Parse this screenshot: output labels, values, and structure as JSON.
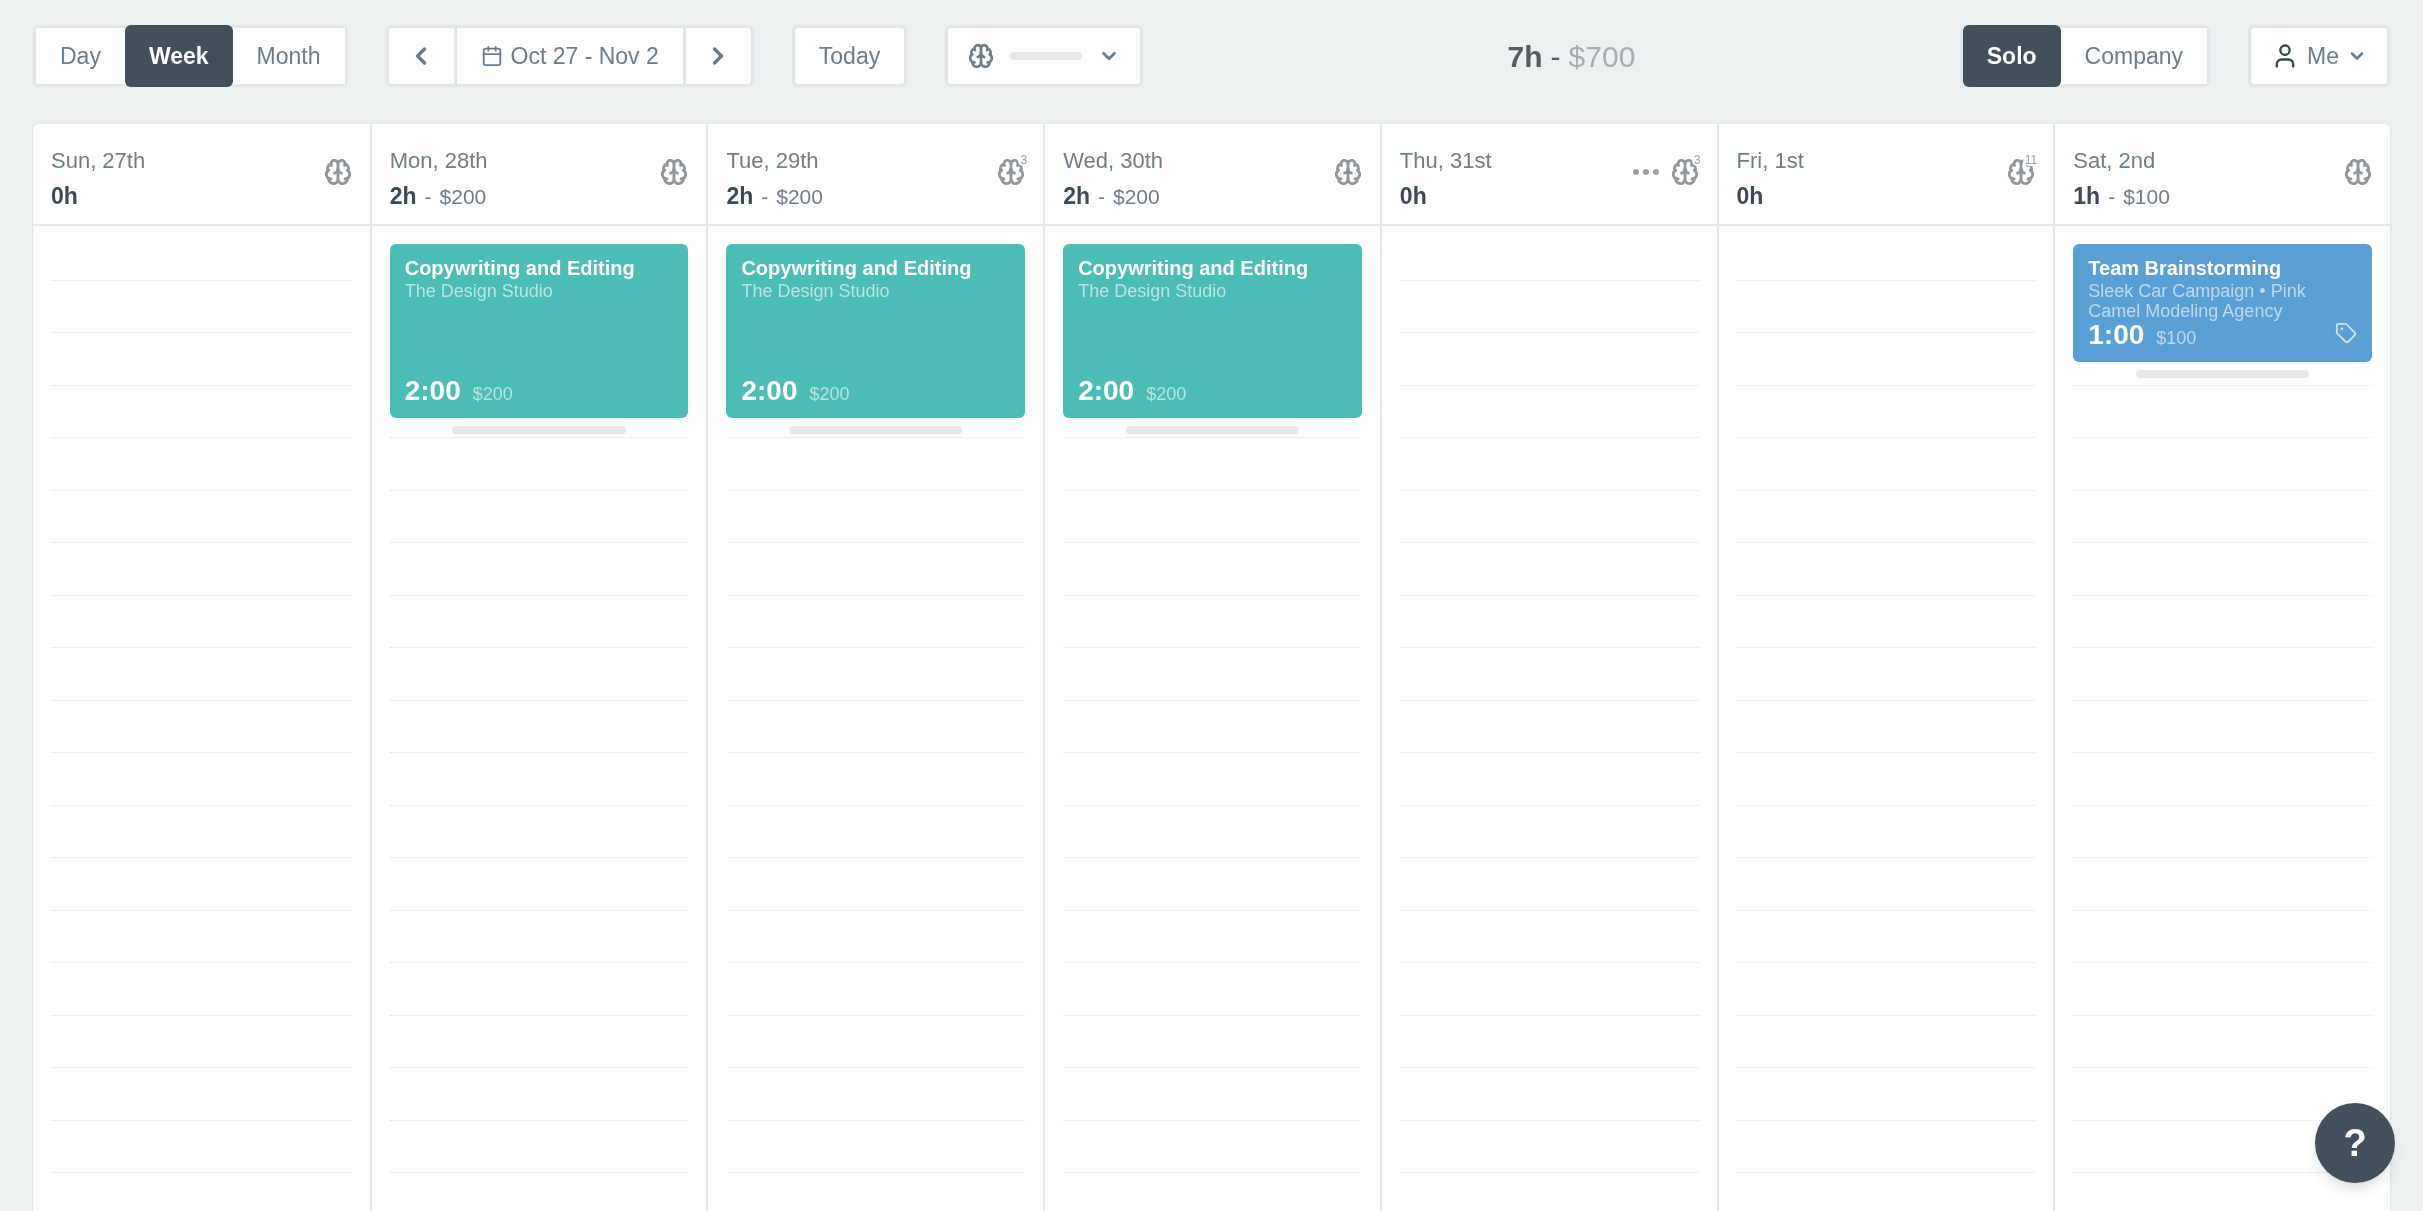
{
  "view_tabs": [
    {
      "label": "Day",
      "selected": false
    },
    {
      "label": "Week",
      "selected": true
    },
    {
      "label": "Month",
      "selected": false
    }
  ],
  "date_nav": {
    "range": "Oct 27 - Nov 2"
  },
  "today_button": "Today",
  "totals": {
    "hours": "7h",
    "separator": "-",
    "amount": "$700"
  },
  "mode_tabs": [
    {
      "label": "Solo",
      "selected": true
    },
    {
      "label": "Company",
      "selected": false
    }
  ],
  "user_menu": {
    "label": "Me"
  },
  "days": [
    {
      "label": "Sun, 27th",
      "hours": "0h"
    },
    {
      "label": "Mon, 28th",
      "hours": "2h",
      "separator": "-",
      "amount": "$200",
      "events": [
        {
          "title": "Copywriting and Editing",
          "subtitle": "The Design Studio",
          "duration": "2:00",
          "amount": "$200",
          "color": "#4bbdb5",
          "tagged": false
        }
      ]
    },
    {
      "label": "Tue, 29th",
      "hours": "2h",
      "separator": "-",
      "amount": "$200",
      "badge": "3",
      "events": [
        {
          "title": "Copywriting and Editing",
          "subtitle": "The Design Studio",
          "duration": "2:00",
          "amount": "$200",
          "color": "#4bbdb5",
          "tagged": false
        }
      ]
    },
    {
      "label": "Wed, 30th",
      "hours": "2h",
      "separator": "-",
      "amount": "$200",
      "events": [
        {
          "title": "Copywriting and Editing",
          "subtitle": "The Design Studio",
          "duration": "2:00",
          "amount": "$200",
          "color": "#4bbdb5",
          "tagged": false
        }
      ]
    },
    {
      "label": "Thu, 31st",
      "hours": "0h",
      "badge": "3",
      "more": true
    },
    {
      "label": "Fri, 1st",
      "hours": "0h",
      "badge": "11"
    },
    {
      "label": "Sat, 2nd",
      "hours": "1h",
      "separator": "-",
      "amount": "$100",
      "events": [
        {
          "title": "Team Brainstorming",
          "subtitle": "Sleek Car Campaign • Pink Camel Modeling Agency",
          "duration": "1:00",
          "amount": "$100",
          "color": "#5a9fd4",
          "tagged": true
        }
      ]
    }
  ],
  "help_button": "?"
}
